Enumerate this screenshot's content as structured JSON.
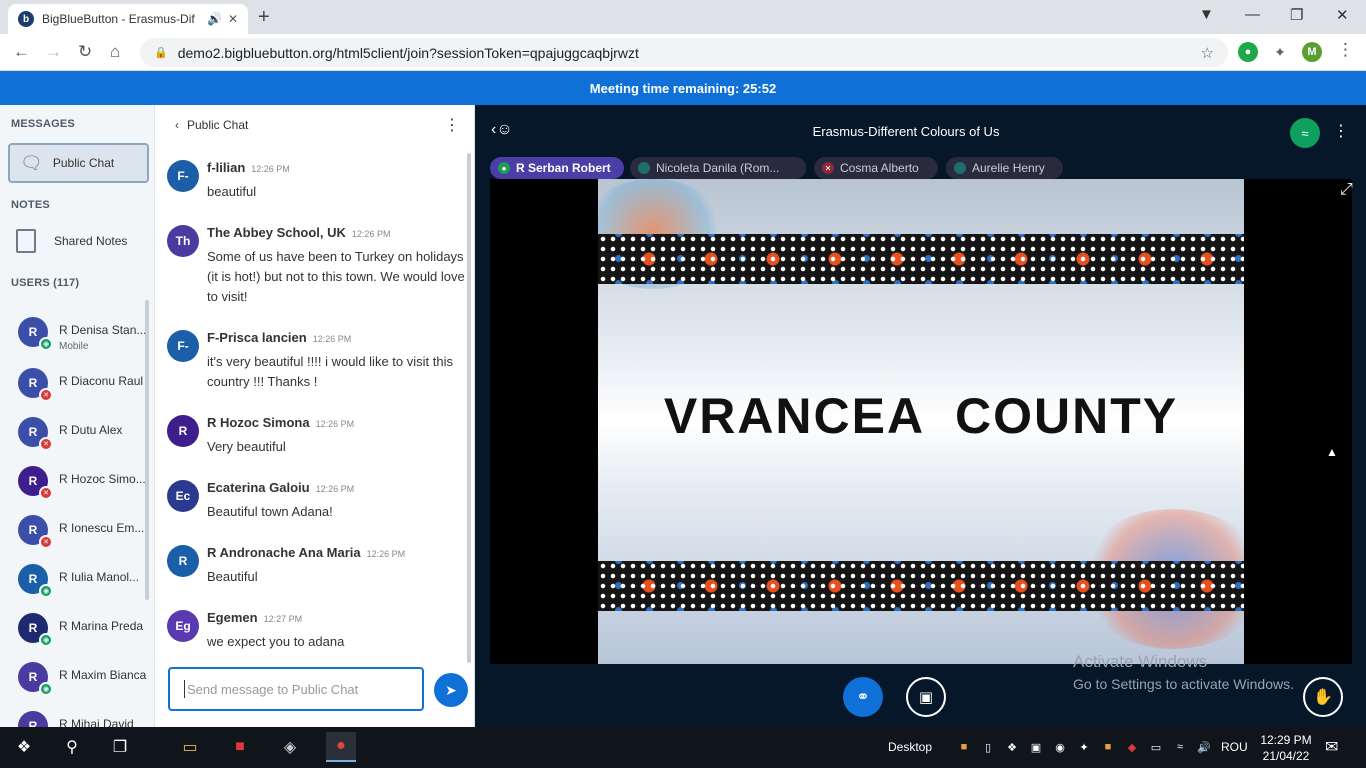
{
  "browser": {
    "tab_title": "BigBlueButton - Erasmus-Dif",
    "url": "demo2.bigbluebutton.org/html5client/join?sessionToken=qpajuggcaqbjrwzt",
    "profile_initial": "M"
  },
  "banner": {
    "text": "Meeting time remaining: 25:52"
  },
  "sidebar": {
    "messages_label": "MESSAGES",
    "public_chat_label": "Public Chat",
    "notes_label": "NOTES",
    "shared_notes_label": "Shared Notes",
    "users_label": "USERS (117)",
    "users": [
      {
        "initial": "R",
        "name": "R Denisa Stan...",
        "sub": "Mobile",
        "status": "listen"
      },
      {
        "initial": "R",
        "name": "R Diaconu Raul",
        "sub": "",
        "status": "muted"
      },
      {
        "initial": "R",
        "name": "R Dutu Alex",
        "sub": "",
        "status": "muted"
      },
      {
        "initial": "R",
        "name": "R Hozoc Simo...",
        "sub": "",
        "status": "muted"
      },
      {
        "initial": "R",
        "name": "R Ionescu Em...",
        "sub": "",
        "status": "muted"
      },
      {
        "initial": "R",
        "name": "R Iulia Manol...",
        "sub": "",
        "status": "listen"
      },
      {
        "initial": "R",
        "name": "R Marina Preda",
        "sub": "",
        "status": "listen"
      },
      {
        "initial": "R",
        "name": "R Maxim Bianca",
        "sub": "",
        "status": "listen"
      },
      {
        "initial": "R",
        "name": "R Mihai David",
        "sub": "",
        "status": "listen"
      }
    ]
  },
  "chat": {
    "header": "Public Chat",
    "input_placeholder": "Send message to Public Chat",
    "messages": [
      {
        "initial": "F-",
        "author": "f-lilian",
        "time": "12:26 PM",
        "text": "beautiful",
        "color": "#1a5fa8"
      },
      {
        "initial": "Th",
        "author": "The Abbey School, UK",
        "time": "12:26 PM",
        "text": "Some of us have been to Turkey on holidays (it is hot!) but not to this town. We would love to visit!",
        "color": "#4b3aa0"
      },
      {
        "initial": "F-",
        "author": "F-Prisca lancien",
        "time": "12:26 PM",
        "text": "it's very beautiful !!!! i would like to visit this country !!! Thanks !",
        "color": "#1a5fa8"
      },
      {
        "initial": "R",
        "author": "R Hozoc Simona",
        "time": "12:26 PM",
        "text": "Very beautiful",
        "color": "#3d1e8c"
      },
      {
        "initial": "Ec",
        "author": "Ecaterina Galoiu",
        "time": "12:26 PM",
        "text": "Beautiful town Adana!",
        "color": "#2a3b8f"
      },
      {
        "initial": "R",
        "author": "R Andronache Ana Maria",
        "time": "12:26 PM",
        "text": "Beautiful",
        "color": "#1a5fa8"
      },
      {
        "initial": "Eg",
        "author": "Egemen",
        "time": "12:27 PM",
        "text": "we expect you to adana",
        "color": "#5a3ab0"
      }
    ]
  },
  "main": {
    "meeting_title": "Erasmus-Different Colours of Us",
    "talkers": [
      {
        "name": "R Serban Robert",
        "active": true,
        "color": "#1e9e5a"
      },
      {
        "name": "Nicoleta Danila (Rom...",
        "active": false,
        "color": "#1e6e6e"
      },
      {
        "name": "Cosma Alberto",
        "active": false,
        "color": "#8a2b3a"
      },
      {
        "name": "Aurelie Henry",
        "active": false,
        "color": "#1e6e6e"
      }
    ],
    "slide_title": "VRANCEA  COUNTY",
    "watermark_line1": "Activate Windows",
    "watermark_line2": "Go to Settings to activate Windows."
  },
  "taskbar": {
    "desktop_label": "Desktop",
    "language": "ROU",
    "time": "12:29 PM",
    "date": "21/04/22"
  }
}
